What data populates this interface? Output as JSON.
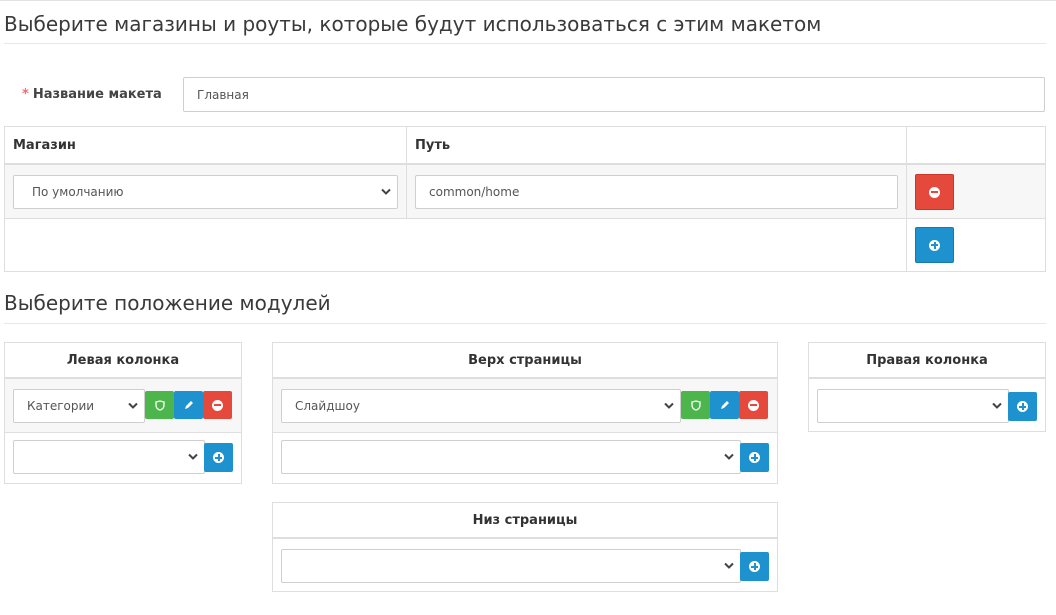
{
  "heading_stores": "Выберите магазины и роуты, которые будут использоваться с этим макетом",
  "layout_name": {
    "label": "Название макета",
    "required_mark": "*",
    "value": "Главная"
  },
  "route_table": {
    "columns": [
      "Магазин",
      "Путь",
      ""
    ],
    "rows": [
      {
        "store": "По умолчанию",
        "route": "common/home"
      }
    ]
  },
  "heading_modules": "Выберите положение модулей",
  "positions": {
    "column_left": {
      "title": "Левая колонка",
      "module": "Категории",
      "new_module": ""
    },
    "content_top": {
      "title": "Верх страницы",
      "module": "Слайдшоу",
      "new_module": ""
    },
    "column_right": {
      "title": "Правая колонка",
      "new_module": ""
    },
    "content_bottom": {
      "title": "Низ страницы",
      "new_module": ""
    }
  },
  "icons": {
    "remove": "minus-circle-icon",
    "add": "plus-circle-icon",
    "edit": "pencil-icon",
    "module_settings": "shield-icon",
    "dropdown": "chevron-down-icon"
  },
  "colors": {
    "red": "#e4493c",
    "blue": "#1e91cf",
    "green": "#4cb64c",
    "required": "#f56b6b"
  }
}
